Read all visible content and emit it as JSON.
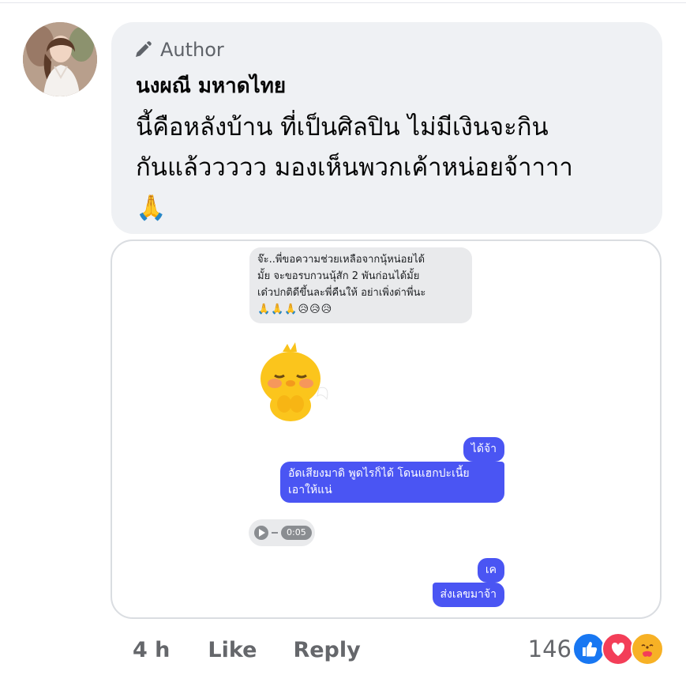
{
  "comment": {
    "badge_label": "Author",
    "author_name": "นงผณี มหาดไทย",
    "text_line1": "นี้คือหลังบ้าน ที่เป็นศิลปิน ไม่มีเงินจะกิน",
    "text_line2": "กันแล้ววววว มองเห็นพวกเค้าหน่อยจ้าาาา",
    "text_emoji": "🙏",
    "badge_icon": "pencil-icon"
  },
  "chat": {
    "received_line1": "จ๊ะ..พี่ขอความช่วยเหลือจากนุ้หน่อยได้",
    "received_line2": "มั้ย จะขอรบกวนนุ้สัก 2 พันก่อนได้มั้ย",
    "received_line3": "เด๋วปกติดีขึ้นละพี่คืนให้ อย่าเพิ่งด่าพี่นะ",
    "received_emojis": "🙏🙏🙏😥😥😥",
    "sent1": "ได้จ้า",
    "sent2_line1": "อัดเสียงมาดิ พูดไรก็ได้ โดนแฮกปะเนี้ย",
    "sent2_line2": "เอาให้แน่",
    "audio_duration": "0:05",
    "sent3": "เค",
    "sent4": "ส่งเลขมาจ้า"
  },
  "footer": {
    "time": "4 h",
    "like_label": "Like",
    "reply_label": "Reply",
    "reaction_count": "146",
    "reactions": [
      "like-icon",
      "love-icon",
      "care-icon"
    ]
  },
  "colors": {
    "bubble_bg": "#eff1f4",
    "sent_bubble": "#4a55f3",
    "meta_text": "#65676b",
    "like_blue": "#1877f2",
    "love_red": "#f33e58",
    "care_yellow": "#f7b125"
  }
}
